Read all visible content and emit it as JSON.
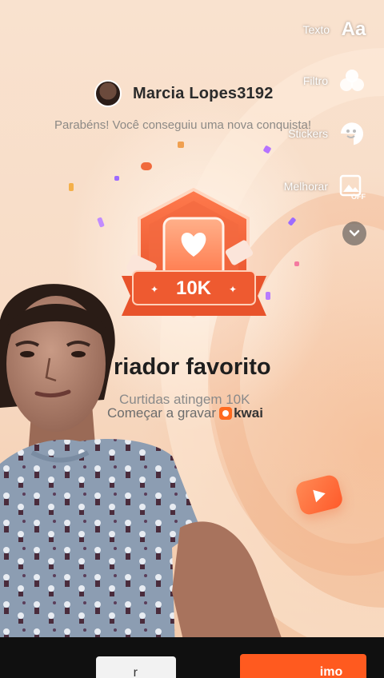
{
  "header": {
    "username": "Marcia Lopes3192",
    "congrats_text": "Parabéns! Você conseguiu uma nova conquista!"
  },
  "badge": {
    "value_label": "10K",
    "title_visible": "riador favorito",
    "subtitle": "Curtidas atingem 10K",
    "cta_text": "Começar a gravar",
    "brand": "kwai"
  },
  "tools": {
    "text_label": "Texto",
    "text_icon_glyph": "Aa",
    "filter_label": "Filtro",
    "stickers_label": "Stickers",
    "enhance_label": "Melhorar",
    "enhance_badge": "OFF"
  },
  "bottom": {
    "left_button": "r",
    "right_button": "imo"
  },
  "colors": {
    "accent": "#ff5a1f",
    "badge_main": "#f0643a",
    "background": "#f8dcc6"
  }
}
